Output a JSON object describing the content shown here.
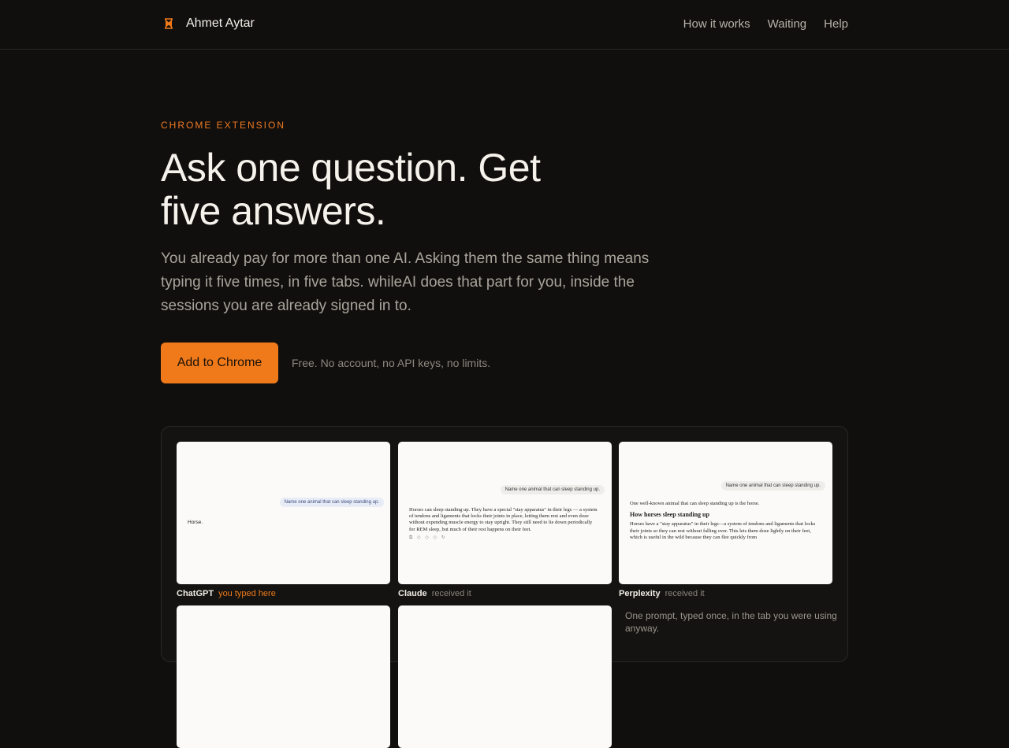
{
  "header": {
    "brand": "Ahmet Aytar",
    "nav": [
      "How it works",
      "Waiting",
      "Help"
    ]
  },
  "hero": {
    "eyebrow": "CHROME EXTENSION",
    "headline": "Ask one question. Get five answers.",
    "lede": "You already pay for more than one AI. Asking them the same thing means typing it five times, in five tabs. whileAI does that part for you, inside the sessions you are already signed in to.",
    "cta": "Add to Chrome",
    "cta_note": "Free. No account, no API keys, no limits."
  },
  "colors": {
    "accent": "#f07a1a",
    "background": "#100f0d"
  },
  "demo": {
    "question": "Name one animal that can sleep standing up.",
    "panels": [
      {
        "model": "ChatGPT",
        "state": "you typed here",
        "answer": "Horse."
      },
      {
        "model": "Claude",
        "state": "received it",
        "answer": "Horses can sleep standing up. They have a special \"stay apparatus\" in their legs — a system of tendons and ligaments that locks their joints in place, letting them rest and even doze without expending muscle energy to stay upright. They still need to lie down periodically for REM sleep, but much of their rest happens on their feet."
      },
      {
        "model": "Perplexity",
        "state": "received it",
        "answer_intro": "One well-known animal that can sleep standing up is the horse.",
        "answer_heading": "How horses sleep standing up",
        "answer": "Horses have a \"stay apparatus\" in their legs—a system of tendons and ligaments that locks their joints so they can rest without falling over. This lets them doze lightly on their feet, which is useful in the wild because they can flee quickly from"
      }
    ],
    "note": "One prompt, typed once, in the tab you were using anyway."
  }
}
